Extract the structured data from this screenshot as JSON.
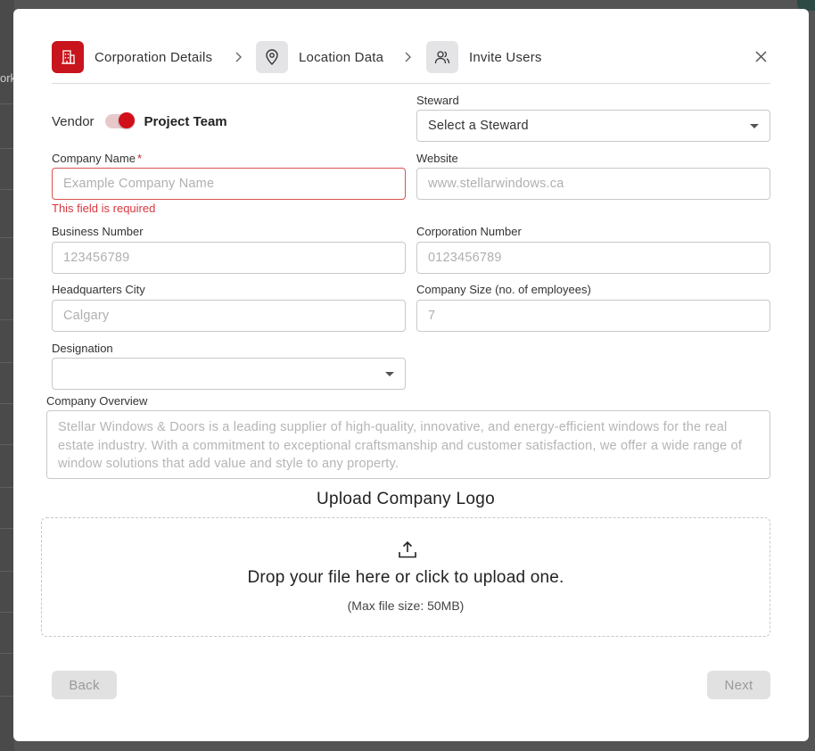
{
  "background": {
    "fragment_text": "ork"
  },
  "stepper": {
    "steps": [
      {
        "label": "Corporation Details",
        "icon": "building-icon",
        "active": true
      },
      {
        "label": "Location Data",
        "icon": "location-pin-icon",
        "active": false
      },
      {
        "label": "Invite Users",
        "icon": "users-icon",
        "active": false
      }
    ]
  },
  "toggle": {
    "left_label": "Vendor",
    "right_label": "Project Team",
    "selected": "Project Team"
  },
  "fields": {
    "steward": {
      "label": "Steward",
      "value": "Select a Steward"
    },
    "company_name": {
      "label": "Company Name",
      "required_mark": "*",
      "placeholder": "Example Company Name",
      "error": "This field is required"
    },
    "website": {
      "label": "Website",
      "placeholder": "www.stellarwindows.ca"
    },
    "business_number": {
      "label": "Business Number",
      "placeholder": "123456789"
    },
    "corporation_number": {
      "label": "Corporation Number",
      "placeholder": "0123456789"
    },
    "hq_city": {
      "label": "Headquarters City",
      "placeholder": "Calgary"
    },
    "company_size": {
      "label": "Company Size (no. of employees)",
      "placeholder": "7"
    },
    "designation": {
      "label": "Designation",
      "value": ""
    },
    "overview": {
      "label": "Company Overview",
      "placeholder": "Stellar Windows & Doors is a leading supplier of high-quality, innovative, and energy-efficient windows for the real estate industry. With a commitment to exceptional craftsmanship and customer satisfaction, we offer a wide range of window solutions that add value and style to any property."
    }
  },
  "upload": {
    "title": "Upload Company Logo",
    "drop_text": "Drop your file here or click to upload one.",
    "max_size": "(Max file size: 50MB)"
  },
  "buttons": {
    "back": "Back",
    "next": "Next"
  },
  "colors": {
    "accent": "#c8141c",
    "error": "#d9363e",
    "disabled": "#e1e1e1"
  }
}
